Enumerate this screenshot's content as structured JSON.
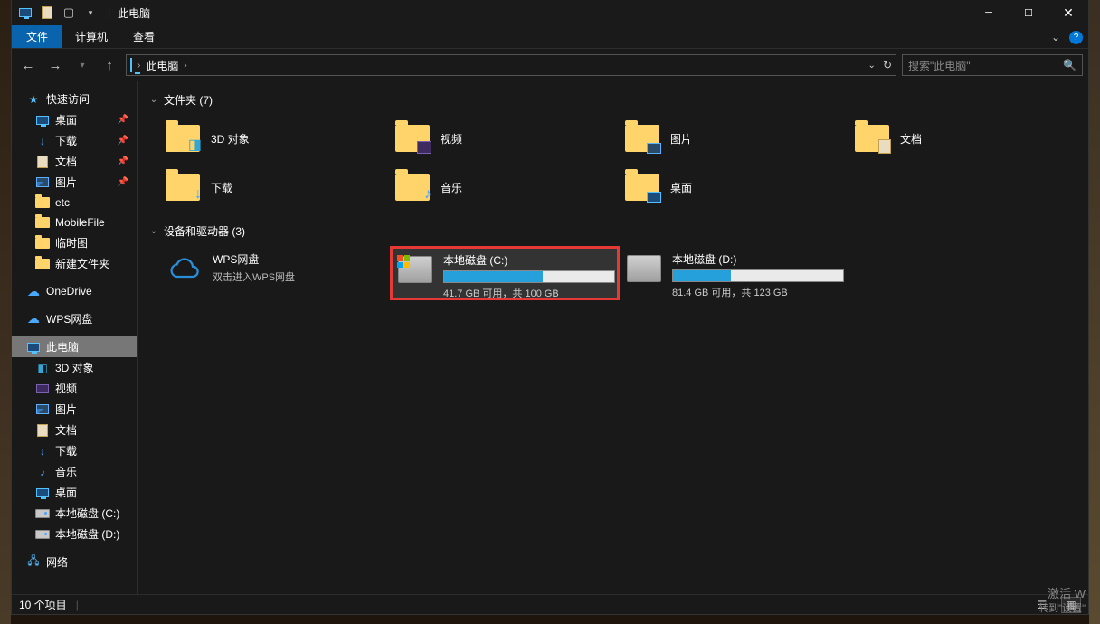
{
  "titlebar": {
    "title": "此电脑"
  },
  "menubar": {
    "file": "文件",
    "tabs": [
      "计算机",
      "查看"
    ]
  },
  "address": {
    "crumb": "此电脑"
  },
  "search": {
    "placeholder": "搜索\"此电脑\""
  },
  "sidebar": {
    "quick_access": "快速访问",
    "quick_items": [
      {
        "label": "桌面",
        "icon": "monitor",
        "pin": true
      },
      {
        "label": "下载",
        "icon": "down",
        "pin": true
      },
      {
        "label": "文档",
        "icon": "doc",
        "pin": true
      },
      {
        "label": "图片",
        "icon": "pic",
        "pin": true
      },
      {
        "label": "etc",
        "icon": "folder",
        "pin": false
      },
      {
        "label": "MobileFile",
        "icon": "folder",
        "pin": false
      },
      {
        "label": "临时图",
        "icon": "folder",
        "pin": false
      },
      {
        "label": "新建文件夹",
        "icon": "folder",
        "pin": false
      }
    ],
    "onedrive": "OneDrive",
    "wps": "WPS网盘",
    "this_pc": "此电脑",
    "pc_items": [
      {
        "label": "3D 对象",
        "icon": "cube"
      },
      {
        "label": "视频",
        "icon": "video"
      },
      {
        "label": "图片",
        "icon": "pic"
      },
      {
        "label": "文档",
        "icon": "doc"
      },
      {
        "label": "下载",
        "icon": "down"
      },
      {
        "label": "音乐",
        "icon": "music"
      },
      {
        "label": "桌面",
        "icon": "monitor"
      },
      {
        "label": "本地磁盘 (C:)",
        "icon": "disk"
      },
      {
        "label": "本地磁盘 (D:)",
        "icon": "disk"
      }
    ],
    "network": "网络"
  },
  "content": {
    "folders_header": "文件夹 (7)",
    "folders": [
      {
        "label": "3D 对象",
        "overlay": "3d"
      },
      {
        "label": "视频",
        "overlay": "vid"
      },
      {
        "label": "图片",
        "overlay": "pic"
      },
      {
        "label": "文档",
        "overlay": "doc"
      },
      {
        "label": "下载",
        "overlay": "down"
      },
      {
        "label": "音乐",
        "overlay": "music"
      },
      {
        "label": "桌面",
        "overlay": "desk"
      }
    ],
    "drives_header": "设备和驱动器 (3)",
    "drives": [
      {
        "name": "WPS网盘",
        "sub": "双击进入WPS网盘",
        "type": "cloud"
      },
      {
        "name": "本地磁盘 (C:)",
        "status": "41.7 GB 可用，共 100 GB",
        "fill": 58,
        "type": "hdd",
        "winlogo": true,
        "selected": true,
        "highlighted": true
      },
      {
        "name": "本地磁盘 (D:)",
        "status": "81.4 GB 可用，共 123 GB",
        "fill": 34,
        "type": "hdd"
      }
    ]
  },
  "status": {
    "items": "10 个项目"
  },
  "watermark": {
    "line1": "激活 W",
    "line2": "转到\"设置\""
  }
}
